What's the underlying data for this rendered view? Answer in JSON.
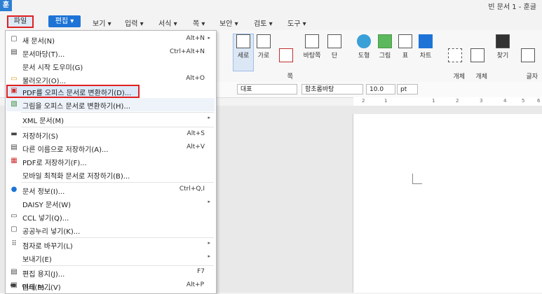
{
  "app": {
    "logo": "훈",
    "title": "빈 문서 1 - 훈글"
  },
  "menubar": {
    "file": "파일",
    "edit": "편집 ▾",
    "items": [
      "보기 ▾",
      "입력 ▾",
      "서식 ▾",
      "쪽 ▾",
      "보안 ▾",
      "검토 ▾",
      "도구 ▾"
    ]
  },
  "ribbon": {
    "groups": [
      "세로",
      "가로",
      "쪽\n여백▾",
      "바탕쪽",
      "단",
      "도형",
      "그림",
      "표",
      "차트",
      "개체\n선택▾",
      "개체\n보호▾",
      "찾기",
      "글자\n바꾸"
    ]
  },
  "fmt": {
    "style": "대표",
    "font": "함초롬바탕",
    "size": "10.0",
    "unit": "pt"
  },
  "ruler_ticks": [
    "2",
    "1",
    "1",
    "2",
    "3",
    "4",
    "5",
    "6"
  ],
  "file_menu": [
    {
      "icon": "new-doc-icon",
      "glyph": "▢",
      "label": "새 문서(N)",
      "shortcut": "Alt+N",
      "arrow": "▸"
    },
    {
      "icon": "template-icon",
      "glyph": "▤",
      "label": "문서마당(T)...",
      "shortcut": "Ctrl+Alt+N"
    },
    {
      "icon": "",
      "glyph": "",
      "label": "문서 시작 도우미(G)",
      "shortcut": ""
    },
    {
      "icon": "open-folder-icon",
      "glyph": "▭",
      "label": "불러오기(O)...",
      "shortcut": "Alt+O"
    },
    {
      "icon": "pdf-convert-icon",
      "glyph": "▣",
      "label": "PDF를 오피스 문서로 변환하기(D)...",
      "shortcut": "",
      "highlight": true
    },
    {
      "icon": "image-convert-icon",
      "glyph": "▧",
      "label": "그림을 오피스 문서로 변환하기(H)...",
      "shortcut": ""
    },
    {
      "icon": "",
      "glyph": "",
      "label": "XML 문서(M)",
      "shortcut": "",
      "arrow": "▸"
    },
    {
      "icon": "save-icon",
      "glyph": "▬",
      "label": "저장하기(S)",
      "shortcut": "Alt+S"
    },
    {
      "icon": "save-as-icon",
      "glyph": "▤",
      "label": "다른 이름으로 저장하기(A)...",
      "shortcut": "Alt+V"
    },
    {
      "icon": "save-pdf-icon",
      "glyph": "▦",
      "label": "PDF로 저장하기(F)...",
      "shortcut": ""
    },
    {
      "icon": "",
      "glyph": "",
      "label": "모바일 최적화 문서로 저장하기(B)...",
      "shortcut": ""
    },
    {
      "icon": "doc-info-icon",
      "glyph": "●",
      "label": "문서 정보(I)...",
      "shortcut": "Ctrl+Q,I"
    },
    {
      "icon": "",
      "glyph": "",
      "label": "DAISY 문서(W)",
      "shortcut": "",
      "arrow": "▸"
    },
    {
      "icon": "ccl-icon",
      "glyph": "▭",
      "label": "CCL 넣기(Q)...",
      "shortcut": ""
    },
    {
      "icon": "public-nuri-icon",
      "glyph": "▢",
      "label": "공공누리 넣기(K)...",
      "shortcut": ""
    },
    {
      "icon": "braille-icon",
      "glyph": "⠿",
      "label": "점자로 바꾸기(L)",
      "shortcut": "",
      "arrow": "▸"
    },
    {
      "icon": "",
      "glyph": "",
      "label": "보내기(E)",
      "shortcut": "",
      "arrow": "▸"
    },
    {
      "icon": "page-setup-icon",
      "glyph": "▤",
      "label": "편집 용지(J)...",
      "shortcut": "F7"
    },
    {
      "icon": "preview-icon",
      "glyph": "▣",
      "label": "미리 보기(V)",
      "shortcut": ""
    },
    {
      "icon": "print-icon",
      "glyph": "▬",
      "label": "인쇄(P)...",
      "shortcut": "Alt+P"
    }
  ]
}
